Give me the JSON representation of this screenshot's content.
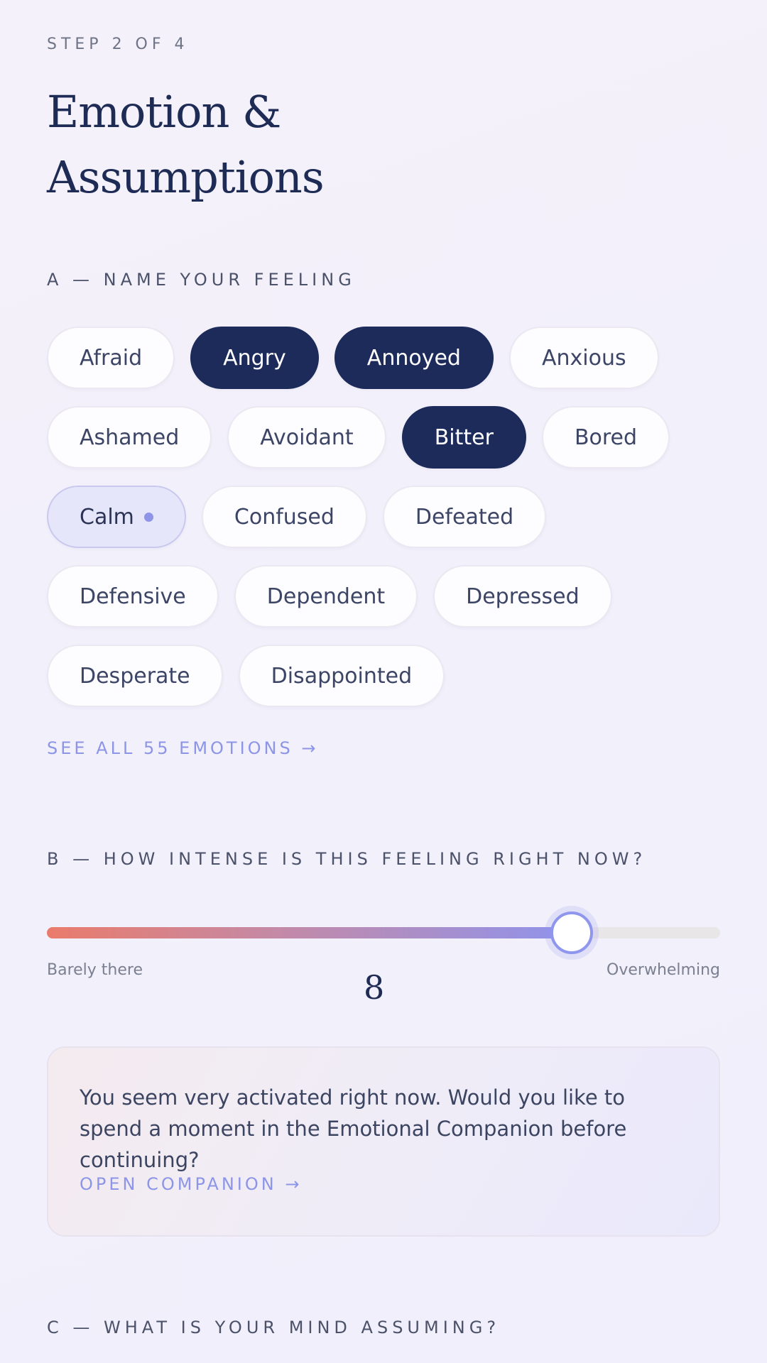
{
  "step": "STEP 2 OF 4",
  "title_line1": "Emotion &",
  "title_line2": "Assumptions",
  "section_a": "A — NAME YOUR FEELING",
  "emotions": [
    [
      {
        "label": "Afraid",
        "state": "default"
      },
      {
        "label": "Angry",
        "state": "selected"
      },
      {
        "label": "Annoyed",
        "state": "selected"
      },
      {
        "label": "Anxious",
        "state": "default"
      }
    ],
    [
      {
        "label": "Ashamed",
        "state": "default"
      },
      {
        "label": "Avoidant",
        "state": "default"
      },
      {
        "label": "Bitter",
        "state": "selected"
      },
      {
        "label": "Bored",
        "state": "default"
      }
    ],
    [
      {
        "label": "Calm",
        "state": "hint"
      },
      {
        "label": "Confused",
        "state": "default"
      },
      {
        "label": "Defeated",
        "state": "default"
      }
    ],
    [
      {
        "label": "Defensive",
        "state": "default"
      },
      {
        "label": "Dependent",
        "state": "default"
      },
      {
        "label": "Depressed",
        "state": "default"
      }
    ],
    [
      {
        "label": "Desperate",
        "state": "default"
      },
      {
        "label": "Disappointed",
        "state": "default"
      }
    ]
  ],
  "see_all_link": "SEE ALL 55 EMOTIONS →",
  "section_b": "B — HOW INTENSE IS THIS FEELING RIGHT NOW?",
  "intensity": {
    "value": "8",
    "level": 0.78,
    "min_label": "Barely there",
    "max_label": "Overwhelming"
  },
  "companion_card": {
    "text": "You seem very activated right now. Would you like to spend a moment in the Emotional Companion before continuing?",
    "link": "OPEN COMPANION →"
  },
  "section_c": "C — WHAT IS YOUR MIND ASSUMING?",
  "colors": {
    "selected_chip": "#1d2b5a",
    "accent": "#8c95e6",
    "slider_start": "#ea7b6b",
    "slider_end": "#8f93ec"
  }
}
